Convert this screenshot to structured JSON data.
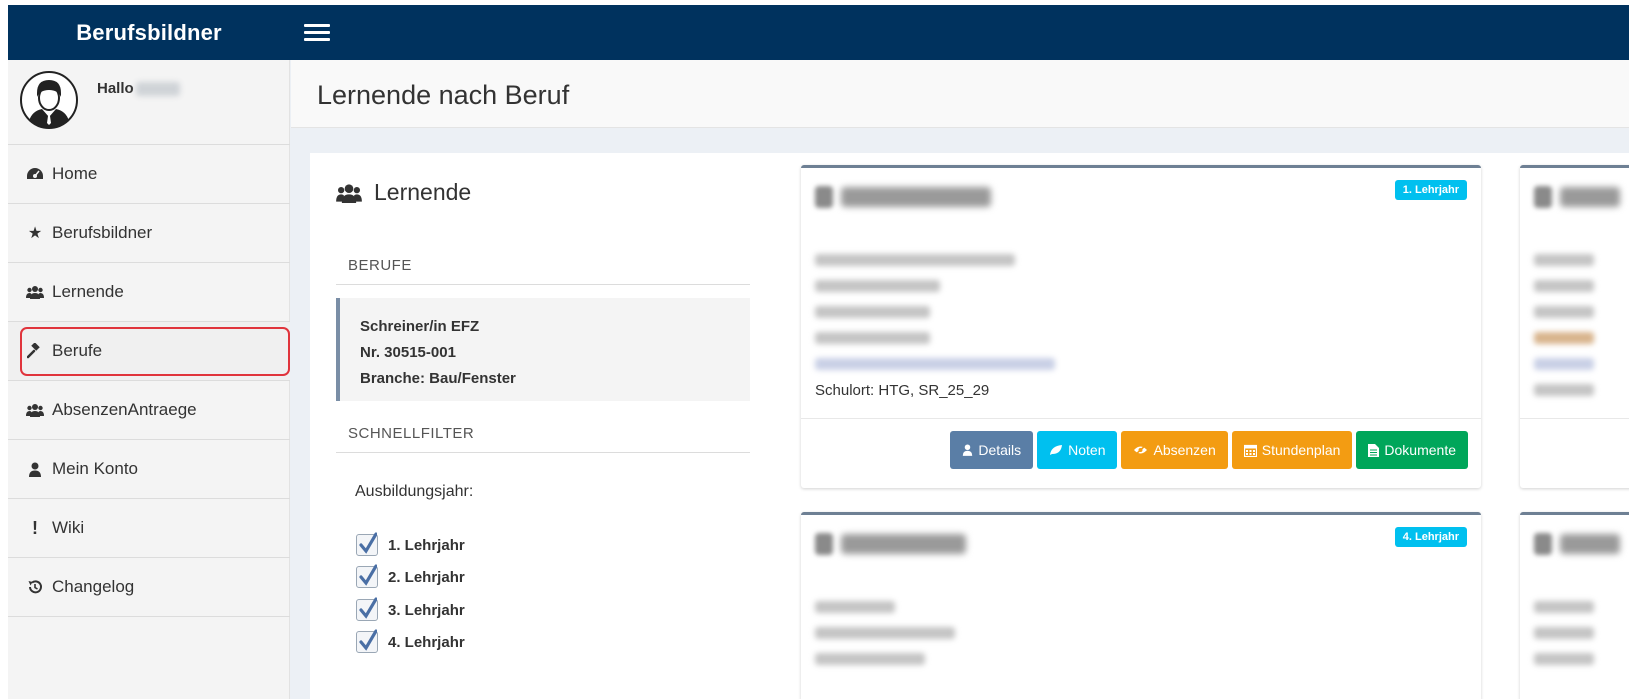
{
  "app": {
    "brand": "Berufsbildner"
  },
  "user": {
    "greeting": "Hallo"
  },
  "sidebar": {
    "items": [
      {
        "label": "Home",
        "icon": "dashboard-icon"
      },
      {
        "label": "Berufsbildner",
        "icon": "star-icon"
      },
      {
        "label": "Lernende",
        "icon": "users-icon"
      },
      {
        "label": "Berufe",
        "icon": "gavel-icon",
        "active": true
      },
      {
        "label": "AbsenzenAntraege",
        "icon": "users-icon"
      },
      {
        "label": "Mein Konto",
        "icon": "user-icon"
      },
      {
        "label": "Wiki",
        "icon": "exclamation-icon"
      },
      {
        "label": "Changelog",
        "icon": "history-icon"
      }
    ]
  },
  "header": {
    "title": "Lernende nach Beruf"
  },
  "panel": {
    "title": "Lernende",
    "berufe_label": "BERUFE",
    "beruf": {
      "name": "Schreiner/in EFZ",
      "nr": "Nr. 30515-001",
      "branche": "Branche: Bau/Fenster"
    },
    "schnellfilter_label": "SCHNELLFILTER",
    "filter_title": "Ausbildungsjahr:",
    "filters": [
      {
        "label": "1. Lehrjahr",
        "checked": true
      },
      {
        "label": "2. Lehrjahr",
        "checked": true
      },
      {
        "label": "3. Lehrjahr",
        "checked": true
      },
      {
        "label": "4. Lehrjahr",
        "checked": true
      }
    ]
  },
  "cards": [
    {
      "badge": "1. Lehrjahr",
      "schulort": "Schulort: HTG, SR_25_29",
      "buttons": {
        "details": "Details",
        "noten": "Noten",
        "absenzen": "Absenzen",
        "stundenplan": "Stundenplan",
        "dokumente": "Dokumente"
      }
    },
    {
      "badge": "4. Lehrjahr"
    }
  ],
  "colors": {
    "topbar": "#00325e",
    "badge": "#00c0ef",
    "details": "#5a7ea6",
    "noten": "#00c0ef",
    "absenzen": "#f39c12",
    "stundenplan": "#f39c12",
    "dokumente": "#00a65a",
    "highlight": "#e0343c"
  }
}
